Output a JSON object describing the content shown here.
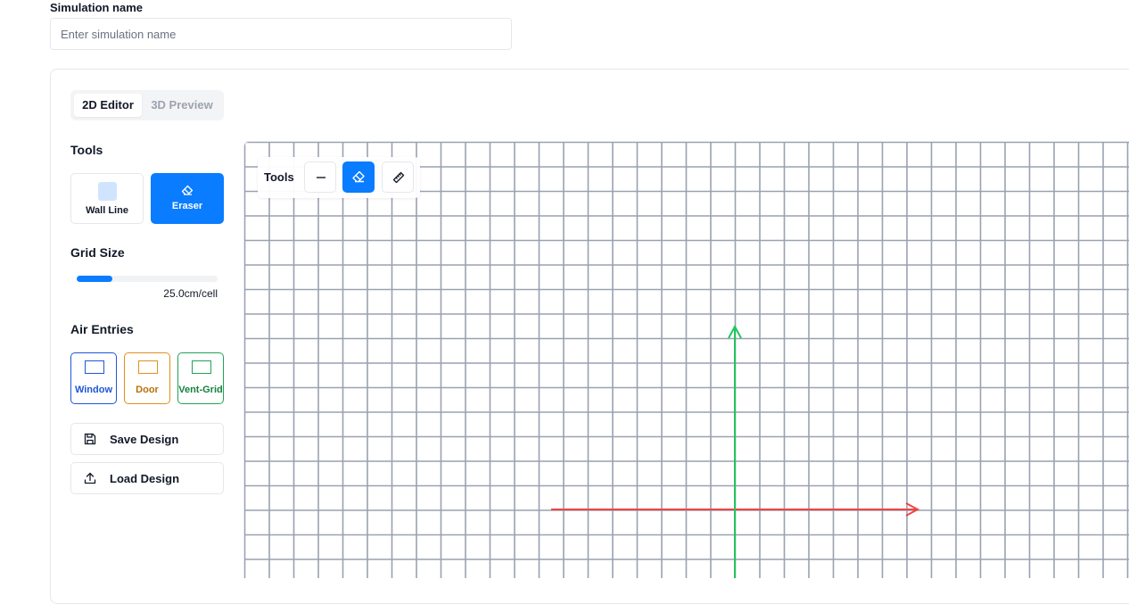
{
  "simulation": {
    "label": "Simulation name",
    "placeholder": "Enter simulation name",
    "value": ""
  },
  "tabs": [
    {
      "label": "2D Editor",
      "active": true
    },
    {
      "label": "3D Preview",
      "active": false
    }
  ],
  "tools": {
    "title": "Tools",
    "items": [
      {
        "label": "Wall Line",
        "icon": "wall-swatch",
        "active": false
      },
      {
        "label": "Eraser",
        "icon": "eraser-icon",
        "active": true
      }
    ]
  },
  "grid": {
    "title": "Grid Size",
    "value_label": "25.0cm/cell",
    "slider_fraction": 0.25
  },
  "air_entries": {
    "title": "Air Entries",
    "items": [
      {
        "label": "Window",
        "color": "#1f56d6"
      },
      {
        "label": "Door",
        "color": "#e0901d"
      },
      {
        "label": "Vent-Grid",
        "color": "#21a355"
      }
    ]
  },
  "actions": {
    "save_label": "Save Design",
    "load_label": "Load Design"
  },
  "canvas_toolbar": {
    "label": "Tools",
    "buttons": [
      "line-icon",
      "eraser-icon",
      "measure-icon"
    ],
    "active": "eraser-icon"
  },
  "colors": {
    "accent": "#0a7cff",
    "grid_line": "#9aa1b0",
    "x_axis": "#ef4444",
    "y_axis": "#22c55e"
  }
}
